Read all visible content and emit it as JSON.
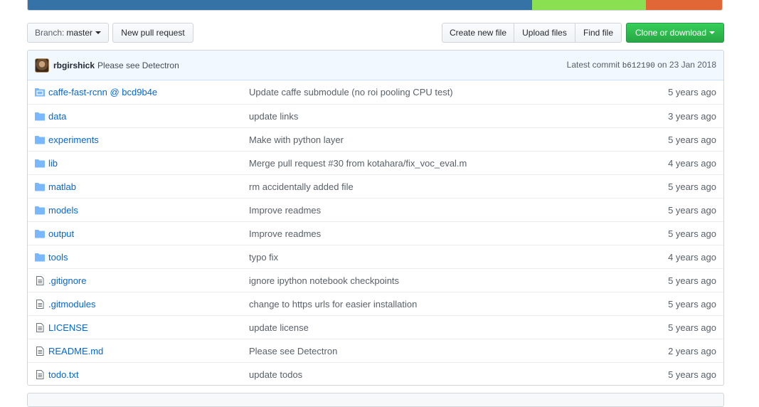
{
  "language_bar": [
    {
      "color": "#3572A5",
      "fraction": 0.726
    },
    {
      "color": "#89e051",
      "fraction": 0.164
    },
    {
      "color": "#e16737",
      "fraction": 0.11
    }
  ],
  "toolbar": {
    "branch_prefix": "Branch:",
    "branch_name": "master",
    "new_pull_request": "New pull request",
    "create_new_file": "Create new file",
    "upload_files": "Upload files",
    "find_file": "Find file",
    "clone_or_download": "Clone or download"
  },
  "commit_tease": {
    "author": "rbgirshick",
    "message": "Please see Detectron",
    "latest_label": "Latest commit",
    "sha": "b612190",
    "date_text": "on 23 Jan 2018"
  },
  "files": [
    {
      "icon": "submodule-icon",
      "name": "caffe-fast-rcnn @ bcd9b4e",
      "message": "Update caffe submodule (no roi pooling CPU test)",
      "age": "5 years ago"
    },
    {
      "icon": "folder-icon",
      "name": "data",
      "message": "update links",
      "age": "3 years ago"
    },
    {
      "icon": "folder-icon",
      "name": "experiments",
      "message": "Make with python layer",
      "age": "5 years ago"
    },
    {
      "icon": "folder-icon",
      "name": "lib",
      "message": "Merge pull request #30 from kotahara/fix_voc_eval.m",
      "age": "4 years ago"
    },
    {
      "icon": "folder-icon",
      "name": "matlab",
      "message": "rm accidentally added file",
      "age": "5 years ago"
    },
    {
      "icon": "folder-icon",
      "name": "models",
      "message": "Improve readmes",
      "age": "5 years ago"
    },
    {
      "icon": "folder-icon",
      "name": "output",
      "message": "Improve readmes",
      "age": "5 years ago"
    },
    {
      "icon": "folder-icon",
      "name": "tools",
      "message": "typo fix",
      "age": "4 years ago"
    },
    {
      "icon": "file-icon",
      "name": ".gitignore",
      "message": "ignore ipython notebook checkpoints",
      "age": "5 years ago"
    },
    {
      "icon": "file-icon",
      "name": ".gitmodules",
      "message": "change to https urls for easier installation",
      "age": "5 years ago"
    },
    {
      "icon": "file-icon",
      "name": "LICENSE",
      "message": "update license",
      "age": "5 years ago"
    },
    {
      "icon": "file-icon",
      "name": "README.md",
      "message": "Please see Detectron",
      "age": "2 years ago"
    },
    {
      "icon": "file-icon",
      "name": "todo.txt",
      "message": "update todos",
      "age": "5 years ago"
    }
  ]
}
